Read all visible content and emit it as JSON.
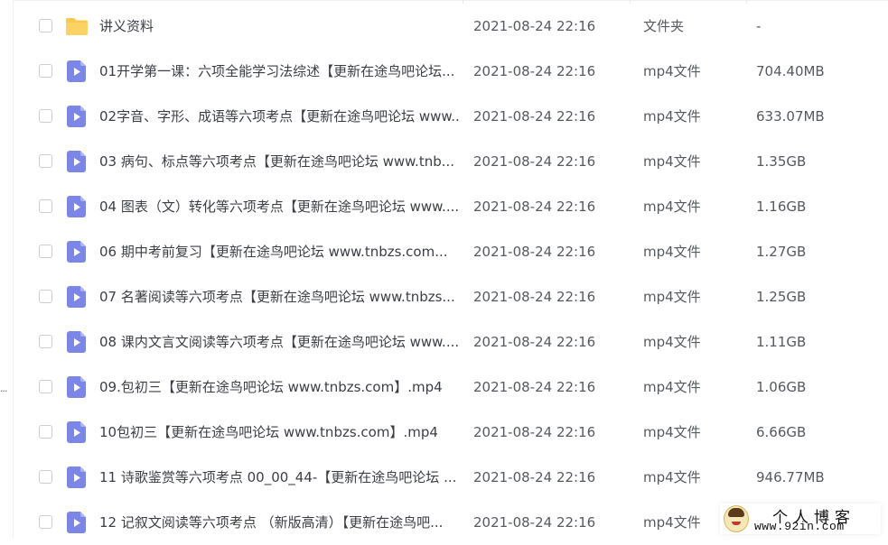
{
  "colors": {
    "folder": "#f9c94e",
    "video_icon": "#7c86e6",
    "text": "#3b3f45",
    "muted_text": "#555a61"
  },
  "files": [
    {
      "name": "讲义资料",
      "date": "2021-08-24 22:16",
      "type": "文件夹",
      "size": "-",
      "icon": "folder-icon"
    },
    {
      "name": "01开学第一课：六项全能学习法综述【更新在途鸟吧论坛...",
      "date": "2021-08-24 22:16",
      "type": "mp4文件",
      "size": "704.40MB",
      "icon": "video-file-icon"
    },
    {
      "name": "02字音、字形、成语等六项考点【更新在途鸟吧论坛 www...",
      "date": "2021-08-24 22:16",
      "type": "mp4文件",
      "size": "633.07MB",
      "icon": "video-file-icon"
    },
    {
      "name": "03 病句、标点等六项考点【更新在途鸟吧论坛 www.tnb...",
      "date": "2021-08-24 22:16",
      "type": "mp4文件",
      "size": "1.35GB",
      "icon": "video-file-icon"
    },
    {
      "name": "04 图表（文）转化等六项考点【更新在途鸟吧论坛 www....",
      "date": "2021-08-24 22:16",
      "type": "mp4文件",
      "size": "1.16GB",
      "icon": "video-file-icon"
    },
    {
      "name": "06 期中考前复习【更新在途鸟吧论坛 www.tnbzs.com...",
      "date": "2021-08-24 22:16",
      "type": "mp4文件",
      "size": "1.27GB",
      "icon": "video-file-icon"
    },
    {
      "name": "07 名著阅读等六项考点【更新在途鸟吧论坛 www.tnbzs...",
      "date": "2021-08-24 22:16",
      "type": "mp4文件",
      "size": "1.25GB",
      "icon": "video-file-icon"
    },
    {
      "name": "08 课内文言文阅读等六项考点【更新在途鸟吧论坛 www....",
      "date": "2021-08-24 22:16",
      "type": "mp4文件",
      "size": "1.11GB",
      "icon": "video-file-icon"
    },
    {
      "name": "09.包初三【更新在途鸟吧论坛 www.tnbzs.com】.mp4",
      "date": "2021-08-24 22:16",
      "type": "mp4文件",
      "size": "1.06GB",
      "icon": "video-file-icon"
    },
    {
      "name": "10包初三【更新在途鸟吧论坛 www.tnbzs.com】.mp4",
      "date": "2021-08-24 22:16",
      "type": "mp4文件",
      "size": "6.66GB",
      "icon": "video-file-icon"
    },
    {
      "name": "11 诗歌鉴赏等六项考点 00_00_44-【更新在途鸟吧论坛 ...",
      "date": "2021-08-24 22:16",
      "type": "mp4文件",
      "size": "946.77MB",
      "icon": "video-file-icon"
    },
    {
      "name": "12 记叙文阅读等六项考点 （新版高清）【更新在途鸟吧...",
      "date": "2021-08-24 22:16",
      "type": "mp4文件",
      "size": "",
      "icon": "video-file-icon"
    }
  ],
  "watermark": {
    "title": "个人博客",
    "url": "www.92in.com"
  },
  "left_edge": {
    "ellipsis": "..."
  }
}
